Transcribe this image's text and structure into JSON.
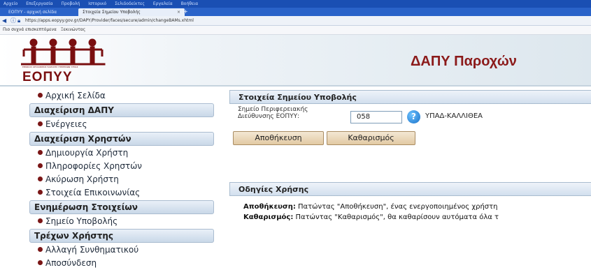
{
  "browser": {
    "menu_items": [
      "Αρχείο",
      "Επεξεργασία",
      "Προβολή",
      "Ιστορικό",
      "Σελιδοδείκτες",
      "Εργαλεία",
      "Βοήθεια"
    ],
    "tabs": [
      {
        "label": "ΕΟΠΥΥ - αρχική σελίδα"
      },
      {
        "label": "Στοιχεία Σημείου Υποβολής"
      }
    ],
    "new_tab": "+",
    "url": "https://apps.eopyy.gov.gr/DAPY/Provider/faces/secure/admin/changeBAMs.xhtml",
    "bookmarks": [
      "Πιο συχνά επισκεπτόμενα",
      "Ξεκινώντας"
    ]
  },
  "header": {
    "logo_text": "ΕΟΠΥΥ",
    "logo_tagline": "ΕΘΝΙΚΟΣ ΟΡΓΑΝΙΣΜΟΣ ΠΑΡΟΧΗΣ ΥΠΗΡΕΣΙΩΝ ΥΓΕΙΑΣ",
    "app_title": "ΔΑΠΥ Παροχών",
    "brand_color": "#7a0f10"
  },
  "sidebar": [
    {
      "type": "item",
      "label": "Αρχική Σελίδα"
    },
    {
      "type": "head",
      "label": "Διαχείριση ΔΑΠΥ"
    },
    {
      "type": "item",
      "label": "Ενέργειες"
    },
    {
      "type": "head",
      "label": "Διαχείριση Χρηστών"
    },
    {
      "type": "item",
      "label": "Δημιουργία Χρήστη"
    },
    {
      "type": "item",
      "label": "Πληροφορίες Χρηστών"
    },
    {
      "type": "item",
      "label": "Ακύρωση Χρήστη"
    },
    {
      "type": "item",
      "label": "Στοιχεία Επικοινωνίας"
    },
    {
      "type": "head",
      "label": "Ενημέρωση Στοιχείων"
    },
    {
      "type": "item",
      "label": "Σημείο Υποβολής"
    },
    {
      "type": "head",
      "label": "Τρέχων Χρήστης"
    },
    {
      "type": "item",
      "label": "Αλλαγή Συνθηματικού"
    },
    {
      "type": "item",
      "label": "Αποσύνδεση"
    }
  ],
  "point_panel": {
    "title": "Στοιχεία Σημείου Υποβολής",
    "field_label": "Σημείο Περιφερειακής Διεύθυνσης ΕΟΠΥΥ:",
    "field_value": "058",
    "help_symbol": "?",
    "point_name": "ΥΠΑΔ-ΚΑΛΛΙΘΕΑ"
  },
  "actions": {
    "save_label": "Αποθήκευση",
    "clear_label": "Καθαρισμός"
  },
  "instructions": {
    "title": "Οδηγίες Χρήσης",
    "lines": [
      {
        "term": "Αποθήκευση:",
        "text": " Πατώντας \"Αποθήκευση\", ένας ενεργοποιημένος χρήστη"
      },
      {
        "term": "Καθαρισμός:",
        "text": " Πατώντας \"Καθαρισμός\", θα καθαρίσουν αυτόματα όλα τ"
      }
    ]
  }
}
